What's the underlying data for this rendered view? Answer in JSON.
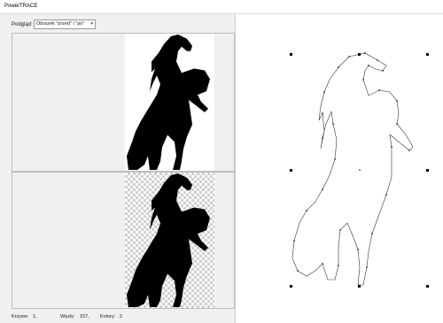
{
  "window": {
    "title": "PowerTRACE"
  },
  "preview": {
    "label": "Podgląd:",
    "selected": "Obrazek \"przed\" i \"po\""
  },
  "status": {
    "curves_label": "Krzywe:",
    "curves_value": "1,",
    "nodes_label": "Węzły:",
    "nodes_value": "157,",
    "colors_label": "Kolory:",
    "colors_value": "2"
  },
  "icons": {
    "dropdown": "chevron-down-icon"
  }
}
